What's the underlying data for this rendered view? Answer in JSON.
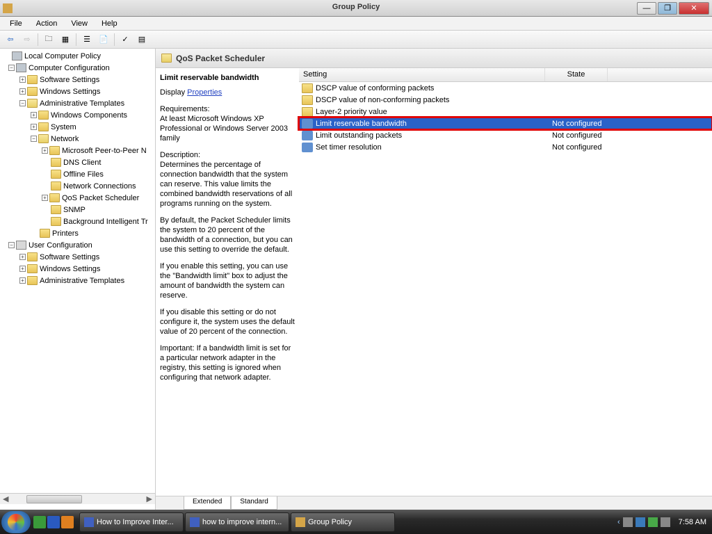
{
  "window": {
    "title": "Group Policy"
  },
  "menu": {
    "file": "File",
    "action": "Action",
    "view": "View",
    "help": "Help"
  },
  "tree": {
    "root": "Local Computer Policy",
    "cc": "Computer Configuration",
    "ss": "Software Settings",
    "ws": "Windows Settings",
    "at": "Administrative Templates",
    "wc": "Windows Components",
    "sys": "System",
    "net": "Network",
    "mspp": "Microsoft Peer-to-Peer N",
    "dns": "DNS Client",
    "off": "Offline Files",
    "nc": "Network Connections",
    "qos": "QoS Packet Scheduler",
    "snmp": "SNMP",
    "bit": "Background Intelligent Tr",
    "prn": "Printers",
    "uc": "User Configuration",
    "uss": "Software Settings",
    "uws": "Windows Settings",
    "uat": "Administrative Templates"
  },
  "header": {
    "title": "QoS Packet Scheduler"
  },
  "desc": {
    "title": "Limit reservable bandwidth",
    "display": "Display",
    "props": "Properties",
    "req_h": "Requirements:",
    "req": "At least Microsoft Windows XP Professional or Windows Server 2003 family",
    "desc_h": "Description:",
    "p1": "Determines the percentage of connection bandwidth that the system can reserve. This value limits the combined bandwidth reservations of all programs running on the system.",
    "p2": "By default, the Packet Scheduler limits the system to 20 percent of the bandwidth of a connection, but you can use this setting to override the default.",
    "p3": "If you enable this setting, you can use the \"Bandwidth limit\" box to adjust the amount of bandwidth the system can reserve.",
    "p4": "If you disable this setting or do not configure it, the system uses the default value of 20 percent of the connection.",
    "p5": "Important: If a bandwidth limit is set for a particular network adapter in the registry, this setting is ignored when configuring that network adapter."
  },
  "cols": {
    "setting": "Setting",
    "state": "State"
  },
  "rows": {
    "r0": {
      "name": "DSCP value of conforming packets",
      "state": ""
    },
    "r1": {
      "name": "DSCP value of non-conforming packets",
      "state": ""
    },
    "r2": {
      "name": "Layer-2 priority value",
      "state": ""
    },
    "r3": {
      "name": "Limit reservable bandwidth",
      "state": "Not configured"
    },
    "r4": {
      "name": "Limit outstanding packets",
      "state": "Not configured"
    },
    "r5": {
      "name": "Set timer resolution",
      "state": "Not configured"
    }
  },
  "tabs": {
    "ext": "Extended",
    "std": "Standard"
  },
  "taskbar": {
    "t0": "How to Improve Inter...",
    "t1": "how to improve intern...",
    "t2": "Group Policy",
    "clock": "7:58 AM"
  }
}
